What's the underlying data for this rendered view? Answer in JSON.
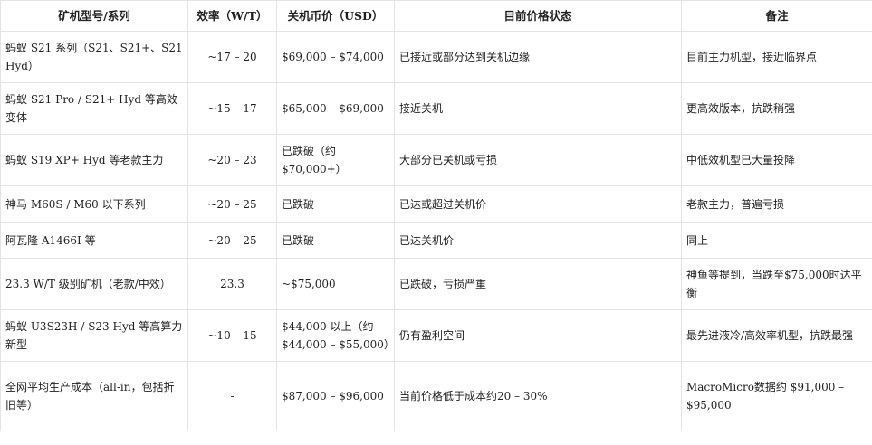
{
  "table": {
    "headers": [
      "矿机型号/系列",
      "效率（W/T）",
      "关机币价（USD）",
      "目前价格状态",
      "备注"
    ],
    "rows": [
      {
        "model": "蚂蚁 S21 系列（S21、S21+、S21 Hyd）",
        "efficiency": "~17 – 20",
        "shutdown_price": "$69,000 – $74,000",
        "status": "已接近或部分达到关机边缘",
        "note": "目前主力机型，接近临界点"
      },
      {
        "model": "蚂蚁 S21 Pro / S21+ Hyd 等高效变体",
        "efficiency": "~15 – 17",
        "shutdown_price": "$65,000 – $69,000",
        "status": "接近关机",
        "note": "更高效版本，抗跌稍强"
      },
      {
        "model": "蚂蚁 S19 XP+ Hyd 等老款主力",
        "efficiency": "~20 – 23",
        "shutdown_price": "已跌破（约 $70,000+）",
        "status": "大部分已关机或亏损",
        "note": "中低效机型已大量投降"
      },
      {
        "model": "神马 M60S / M60 以下系列",
        "efficiency": "~20 – 25",
        "shutdown_price": "已跌破",
        "status": "已达或超过关机价",
        "note": "老款主力，普遍亏损"
      },
      {
        "model": "阿瓦隆 A1466I 等",
        "efficiency": "~20 – 25",
        "shutdown_price": "已跌破",
        "status": "已达关机价",
        "note": "同上"
      },
      {
        "model": "23.3 W/T 级别矿机（老款/中效）",
        "efficiency": "23.3",
        "shutdown_price": "~$75,000",
        "status": "已跌破，亏损严重",
        "note": "神鱼等提到，当跌至$75,000时达平衡"
      },
      {
        "model": "蚂蚁 U3S23H / S23 Hyd 等高算力新型",
        "efficiency": "~10 – 15",
        "shutdown_price": "$44,000 以上（约 $44,000 – $55,000）",
        "status": "仍有盈利空间",
        "note": "最先进液冷/高效率机型，抗跌最强"
      },
      {
        "model": "全网平均生产成本（all-in，包括折旧等）",
        "efficiency": "-",
        "shutdown_price": "$87,000 – $96,000",
        "status": "当前价格低于成本约20 – 30%",
        "note": "MacroMicro数据约 $91,000 – $95,000"
      }
    ]
  }
}
